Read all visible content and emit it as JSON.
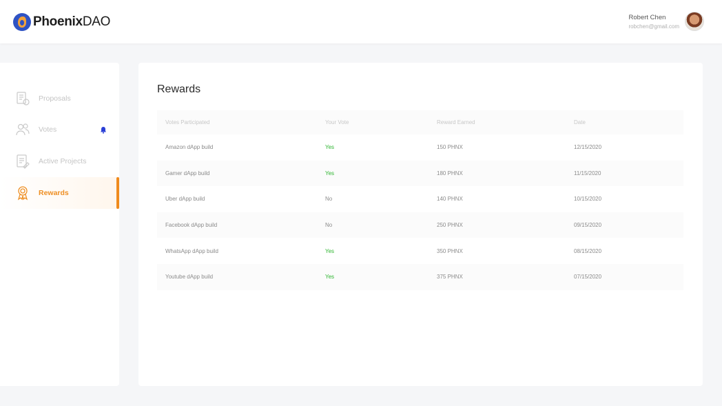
{
  "header": {
    "logo_bold": "Phoenix",
    "logo_light": "DAO",
    "user_name": "Robert Chen",
    "user_email": "robchen@gmail.com"
  },
  "sidebar": {
    "items": [
      {
        "label": "Proposals",
        "icon": "proposals-icon"
      },
      {
        "label": "Votes",
        "icon": "votes-icon"
      },
      {
        "label": "Active Projects",
        "icon": "active-projects-icon"
      },
      {
        "label": "Rewards",
        "icon": "rewards-icon",
        "active": true
      }
    ]
  },
  "main": {
    "title": "Rewards",
    "columns": [
      "Votes Participated",
      "Your Vote",
      "Reward Earned",
      "Date"
    ],
    "rows": [
      {
        "name": "Amazon dApp build",
        "vote": "Yes",
        "reward": "150 PHNX",
        "date": "12/15/2020"
      },
      {
        "name": "Gamer dApp build",
        "vote": "Yes",
        "reward": "180 PHNX",
        "date": "11/15/2020"
      },
      {
        "name": "Uber dApp build",
        "vote": "No",
        "reward": "140 PHNX",
        "date": "10/15/2020"
      },
      {
        "name": "Facebook dApp build",
        "vote": "No",
        "reward": "250 PHNX",
        "date": "09/15/2020"
      },
      {
        "name": "WhatsApp dApp build",
        "vote": "Yes",
        "reward": "350 PHNX",
        "date": "08/15/2020"
      },
      {
        "name": "Youtube dApp build",
        "vote": "Yes",
        "reward": "375 PHNX",
        "date": "07/15/2020"
      }
    ]
  },
  "colors": {
    "accent": "#f08a1c",
    "brand_blue": "#2f53c4",
    "yes_green": "#2fb531",
    "bell_blue": "#2a3fd6"
  }
}
